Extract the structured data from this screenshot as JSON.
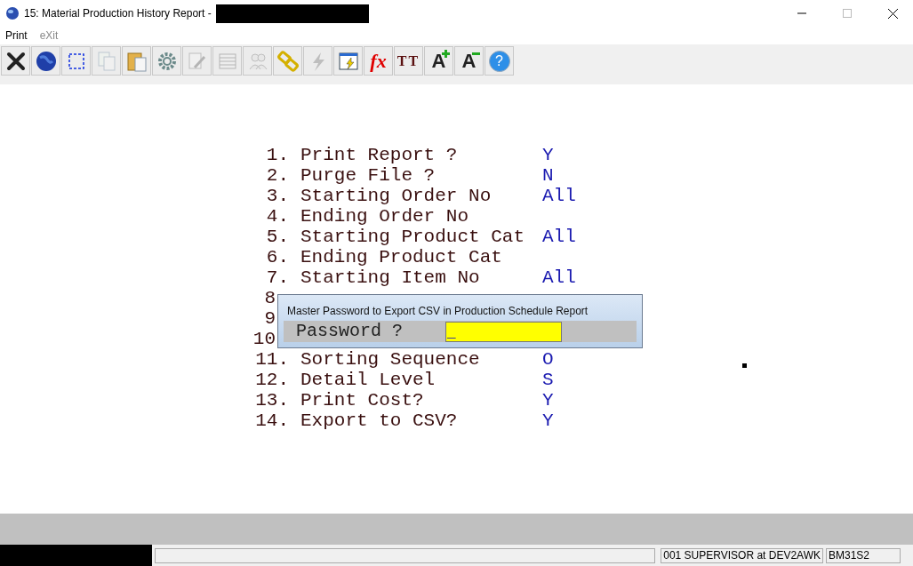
{
  "window": {
    "title": "15: Material Production History Report -"
  },
  "menu": [
    {
      "label": "Print",
      "disabled": false
    },
    {
      "label": "eXit",
      "disabled": true
    }
  ],
  "toolbar": [
    {
      "disabled": false
    },
    {
      "disabled": false
    },
    {
      "disabled": false
    },
    {
      "disabled": true
    },
    {
      "disabled": false
    },
    {
      "disabled": false
    },
    {
      "disabled": true
    },
    {
      "disabled": true
    },
    {
      "disabled": true
    },
    {
      "disabled": false
    },
    {
      "disabled": true
    },
    {
      "disabled": false
    },
    {
      "disabled": false,
      "glyph": "fx"
    },
    {
      "disabled": false,
      "glyph": "TT"
    },
    {
      "disabled": false,
      "glyph": "A"
    },
    {
      "disabled": false,
      "glyph": "A"
    },
    {
      "disabled": false,
      "glyph": "?"
    }
  ],
  "options": [
    {
      "number": "1.",
      "label": "Print Report ?",
      "value": "Y"
    },
    {
      "number": "2.",
      "label": "Purge File ?",
      "value": "N"
    },
    {
      "number": "3.",
      "label": "Starting Order No",
      "value": "All"
    },
    {
      "number": "4.",
      "label": "Ending Order No"
    },
    {
      "number": "5.",
      "label": "Starting Product Cat",
      "value": "All"
    },
    {
      "number": "6.",
      "label": "Ending Product Cat"
    },
    {
      "number": "7.",
      "label": "Starting Item No",
      "value": "All"
    },
    {
      "number": "8"
    },
    {
      "number": "9"
    },
    {
      "number": "10"
    },
    {
      "number": "11.",
      "label": "Sorting Sequence",
      "value": "O"
    },
    {
      "number": "12.",
      "label": "Detail Level",
      "value": "S"
    },
    {
      "number": "13.",
      "label": "Print Cost?",
      "value": "Y"
    },
    {
      "number": "14.",
      "label": "Export to CSV?",
      "value": "Y"
    }
  ],
  "dialog": {
    "title": "Master Password to Export CSV in Production Schedule Report",
    "prompt": "Password ?",
    "cursor": "_"
  },
  "status_bar": {
    "user": "001 SUPERVISOR at DEV2AWK",
    "program": "BM31S2"
  }
}
